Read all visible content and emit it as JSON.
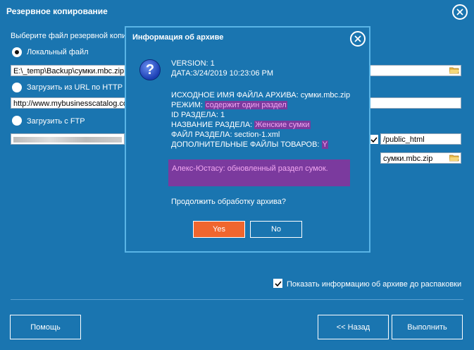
{
  "window": {
    "title": "Резервное копирование"
  },
  "main": {
    "select_label": "Выберите файл резервной копи",
    "local_file_label": "Локальный файл",
    "local_file_value": "E:\\_temp\\Backup\\сумки.mbc.zip",
    "url_label": "Загрузить из URL  по HTTP",
    "url_value": "http://www.mybusinesscatalog.co",
    "ftp_label": "Загрузить с FTP",
    "ftp_path_value": "/public_html",
    "ftp_file_value": "сумки.mbc.zip",
    "show_info_label": "Показать информацию об архиве до распаковки"
  },
  "footer": {
    "help_label": "Помощь",
    "back_label": "<< Назад",
    "run_label": "Выполнить"
  },
  "modal": {
    "title": "Информация об архиве",
    "version": "VERSION: 1",
    "date": "ДАТА:3/24/2019 10:23:06 PM",
    "orig_name": "ИСХОДНОЕ ИМЯ ФАЙЛА АРХИВА: сумки.mbc.zip",
    "mode_label": "РЕЖИМ: ",
    "mode_value": "содержит один раздел",
    "section_id": "ID РАЗДЕЛА: 1",
    "section_name_label": "НАЗВАНИЕ РАЗДЕЛА: ",
    "section_name_value": "Женские сумки",
    "section_file": "ФАЙЛ РАЗДЕЛА: section-1.xml",
    "extra_files_label": "ДОПОЛНИТЕЛЬНЫЕ ФАЙЛЫ ТОВАРОВ: ",
    "extra_files_value": "Y",
    "comment": "Алекс-Юстасу: обновленный раздел сумок.",
    "question": "Продолжить обработку архива?",
    "yes_label": "Yes",
    "no_label": "No"
  },
  "colors": {
    "background": "#1a75b0",
    "accent": "#f0662e",
    "highlight": "#7b3a9e",
    "modal_border": "#59b4e6"
  }
}
